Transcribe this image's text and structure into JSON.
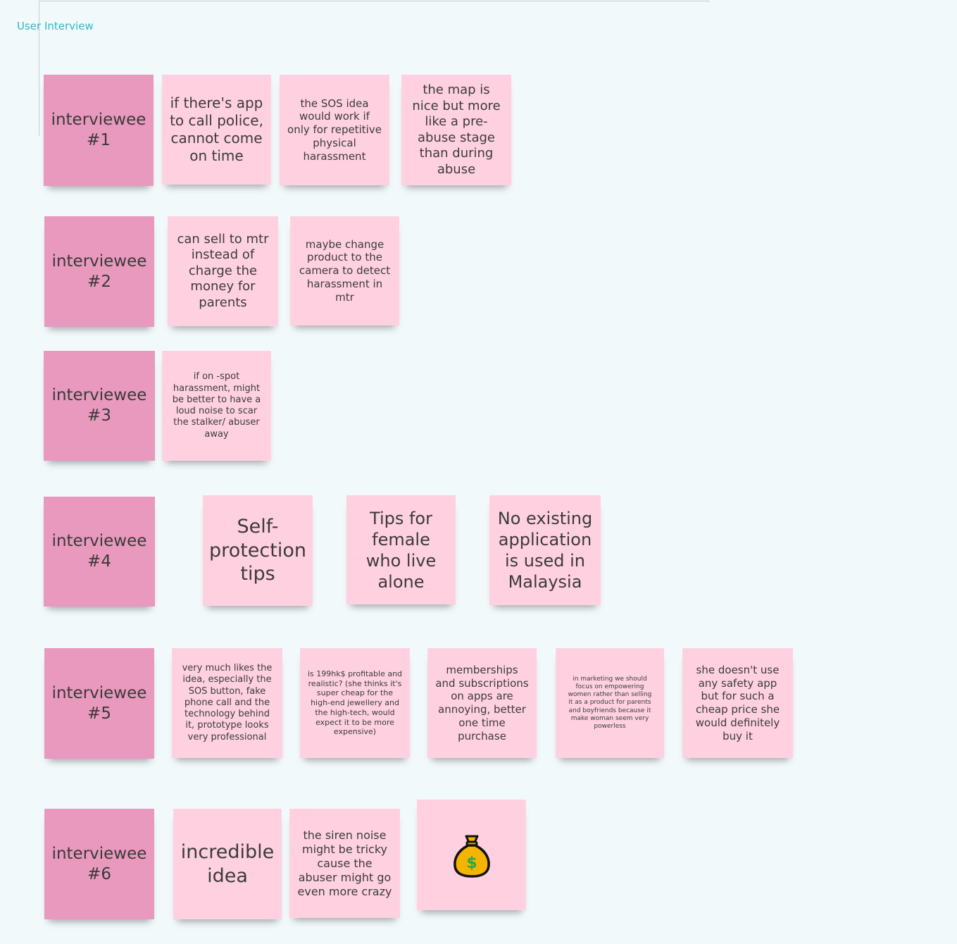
{
  "frame": {
    "title": "User Interview"
  },
  "colors": {
    "header_note": "#e899bd",
    "body_note": "#ffd1e0",
    "frame_title": "#2fb8c6"
  },
  "rows": [
    {
      "header": "interviewee #1",
      "notes": [
        "if there's app to call police, cannot come on time",
        "the SOS idea would work if only for repetitive physical harassment",
        "the map is nice but more like a pre-abuse stage than during abuse"
      ]
    },
    {
      "header": "interviewee #2",
      "notes": [
        "can sell to mtr instead of charge the money for parents",
        "maybe change product to the camera to detect harassment in mtr"
      ]
    },
    {
      "header": "interviewee #3",
      "notes": [
        "if on -spot harassment, might be better to have a loud noise to scar the stalker/ abuser away"
      ]
    },
    {
      "header": "interviewee #4",
      "notes": [
        "Self-protection tips",
        "Tips for female who live alone",
        "No existing application is used in Malaysia"
      ]
    },
    {
      "header": "interviewee #5",
      "notes": [
        "very much likes the idea, especially the SOS button, fake phone call and the technology behind it, prototype looks very professional",
        "is 199hk$ profitable and realistic? (she thinks it's super cheap for the high-end jewellery and the high-tech, would expect it to be more expensive)",
        "memberships and subscriptions on apps are annoying, better one time purchase",
        "in marketing we should focus on empowering women rather than selling it as a product for parents and boyfriends because it make woman seem very powerless",
        "she doesn't use any safety app but for such a cheap price she would definitely buy it"
      ]
    },
    {
      "header": "interviewee #6",
      "notes": [
        "incredible idea",
        "the siren noise might be tricky cause the abuser might go even more crazy"
      ],
      "icon": "money-bag-icon"
    }
  ]
}
